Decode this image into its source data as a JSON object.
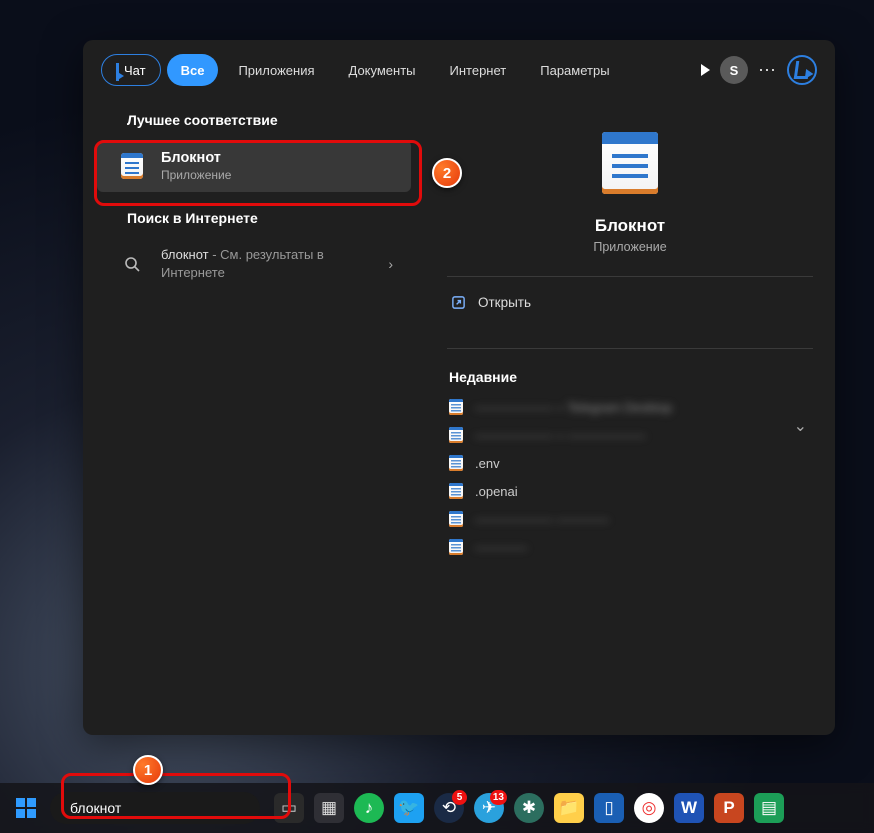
{
  "header": {
    "chat_label": "Чат",
    "tabs": [
      "Все",
      "Приложения",
      "Документы",
      "Интернет",
      "Параметры"
    ],
    "avatar_initial": "S"
  },
  "left": {
    "best_header": "Лучшее соответствие",
    "best_item": {
      "title": "Блокнот",
      "subtitle": "Приложение"
    },
    "web_header": "Поиск в Интернете",
    "web_item": {
      "query": "блокнот",
      "suffix": " - См. результаты в Интернете"
    }
  },
  "detail": {
    "title": "Блокнот",
    "subtitle": "Приложение",
    "open_label": "Открыть",
    "recent_header": "Недавние",
    "recent": [
      {
        "label": "—————— – Telegram Desktop",
        "blurred": true
      },
      {
        "label": "—————— – ——————",
        "blurred": true
      },
      {
        "label": ".env",
        "blurred": false
      },
      {
        "label": ".openai",
        "blurred": false
      },
      {
        "label": "—————— ————",
        "blurred": true
      },
      {
        "label": "————",
        "blurred": true
      }
    ]
  },
  "taskbar": {
    "search_value": "блокнот",
    "steam_badge": "5",
    "telegram_badge": "13",
    "icons": [
      {
        "name": "task-view-icon",
        "bg": "#2a2a2a",
        "glyph": "▭",
        "color": "#ccc"
      },
      {
        "name": "calculator-icon",
        "bg": "#2f2f35",
        "glyph": "▦",
        "color": "#ddd"
      },
      {
        "name": "spotify-icon",
        "bg": "#1db954",
        "glyph": "♪",
        "circle": true
      },
      {
        "name": "twitter-icon",
        "bg": "#1da1f2",
        "glyph": "🐦"
      },
      {
        "name": "steam-icon",
        "bg": "#1a2a45",
        "glyph": "⟲",
        "circle": true,
        "badge_key": "steam_badge"
      },
      {
        "name": "telegram-icon",
        "bg": "#2aa1dd",
        "glyph": "✈",
        "circle": true,
        "badge_key": "telegram_badge"
      },
      {
        "name": "chatgpt-icon",
        "bg": "#2c6e5f",
        "glyph": "✱",
        "circle": true
      },
      {
        "name": "explorer-icon",
        "bg": "#ffcf4a",
        "glyph": "📁"
      },
      {
        "name": "phone-link-icon",
        "bg": "#1a5fb4",
        "glyph": "▯"
      },
      {
        "name": "chrome-icon",
        "bg": "#fff",
        "glyph": "◎",
        "circle": true,
        "color": "#e33"
      },
      {
        "name": "word-icon",
        "bg": "#1f53b5",
        "glyph": "W",
        "bold": true
      },
      {
        "name": "powerpoint-icon",
        "bg": "#c8461f",
        "glyph": "P",
        "bold": true
      },
      {
        "name": "sheets-icon",
        "bg": "#1c9e57",
        "glyph": "▤"
      }
    ]
  },
  "callouts": {
    "badge1": "1",
    "badge2": "2"
  }
}
